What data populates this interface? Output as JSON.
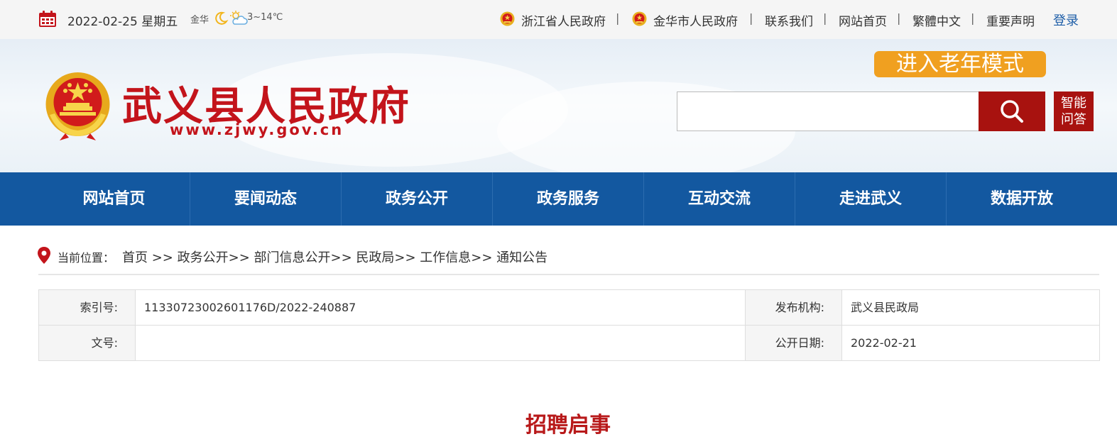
{
  "topbar": {
    "date": "2022-02-25 星期五",
    "weather": {
      "city": "金华",
      "temp": "3~14℃",
      "icons": [
        "moon-icon",
        "cloud-sun-icon"
      ]
    },
    "links": [
      "浙江省人民政府",
      "金华市人民政府",
      "联系我们",
      "网站首页",
      "繁體中文",
      "重要声明"
    ],
    "separator": "|",
    "login": "登录"
  },
  "header": {
    "title": "武义县人民政府",
    "url": "www.zjwy.gov.cn",
    "elder_mode": "进入老年模式",
    "search": {
      "value": "",
      "placeholder": ""
    },
    "qa_line1": "智能",
    "qa_line2": "问答"
  },
  "nav": [
    "网站首页",
    "要闻动态",
    "政务公开",
    "政务服务",
    "互动交流",
    "走进武义",
    "数据开放"
  ],
  "breadcrumb": {
    "label": "当前位置：",
    "path": "首页 >> 政务公开>> 部门信息公开>> 民政局>> 工作信息>> 通知公告"
  },
  "meta": {
    "index_label": "索引号:",
    "index_value": "11330723002601176D/2022-240887",
    "publisher_label": "发布机构:",
    "publisher_value": "武义县民政局",
    "docno_label": "文号:",
    "docno_value": "",
    "date_label": "公开日期:",
    "date_value": "2022-02-21"
  },
  "article": {
    "title": "招聘启事"
  },
  "colors": {
    "brand_red": "#c3141b",
    "nav_blue": "#1358a0",
    "elder_orange": "#f0a020",
    "button_red": "#a8120f"
  }
}
